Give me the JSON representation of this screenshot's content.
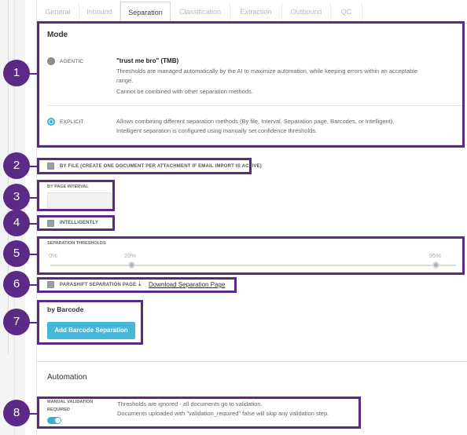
{
  "tabs": [
    {
      "label": "General"
    },
    {
      "label": "Inbound"
    },
    {
      "label": "Separation",
      "active": true
    },
    {
      "label": "Classification"
    },
    {
      "label": "Extraction"
    },
    {
      "label": "Outbound"
    },
    {
      "label": "QC"
    }
  ],
  "mode": {
    "title": "Mode",
    "agentic": {
      "label": "AGENTIC",
      "name": "\"trust me bro\" (TMB)",
      "desc1": "Thresholds are managed automatically by the AI to maximize automation, while keeping errors within an acceptable",
      "desc2": "range.",
      "desc3": "Cannot be combined with other separation methods.",
      "selected": false
    },
    "explicit": {
      "label": "EXPLICIT",
      "desc1": "Allows combining different separation methods (By file, Interval, Separation page, Barcodes, or Intelligent).",
      "desc2": "Intelligent separation is configured using manually set confidence thresholds.",
      "selected": true
    }
  },
  "by_file": {
    "label": "BY FILE (CREATE ONE DOCUMENT PER ATTACHMENT IF EMAIL IMPORT IS ACTIVE)",
    "checked": false
  },
  "page_interval": {
    "label": "BY PAGE INTERVAL",
    "value": ""
  },
  "intelligently": {
    "label": "INTELLIGENTLY",
    "checked": false
  },
  "thresholds": {
    "label": "SEPARATION THRESHOLDS",
    "min_label": "0%",
    "low_label": "20%",
    "high_label": "95%",
    "low_value": 20,
    "high_value": 95
  },
  "parashift": {
    "label": "PARASHIFT SEPARATION PAGE",
    "checked": false,
    "download_label": "Download Separation Page"
  },
  "barcode": {
    "title": "by Barcode",
    "button": "Add Barcode Separation"
  },
  "automation": {
    "title": "Automation",
    "manual_label_1": "MANUAL VALIDATION",
    "manual_label_2": "REQUIRED",
    "enabled": true,
    "desc1": "Thresholds are ignored - all documents go to validation.",
    "desc2": "Documents uploaded with \"validation_required\" false will skip any validation step."
  },
  "callouts": [
    "1",
    "2",
    "3",
    "4",
    "5",
    "6",
    "7",
    "8"
  ],
  "colors": {
    "accent": "#3ab0d8",
    "callout": "#5b2a86",
    "button": "#45b8d8"
  }
}
